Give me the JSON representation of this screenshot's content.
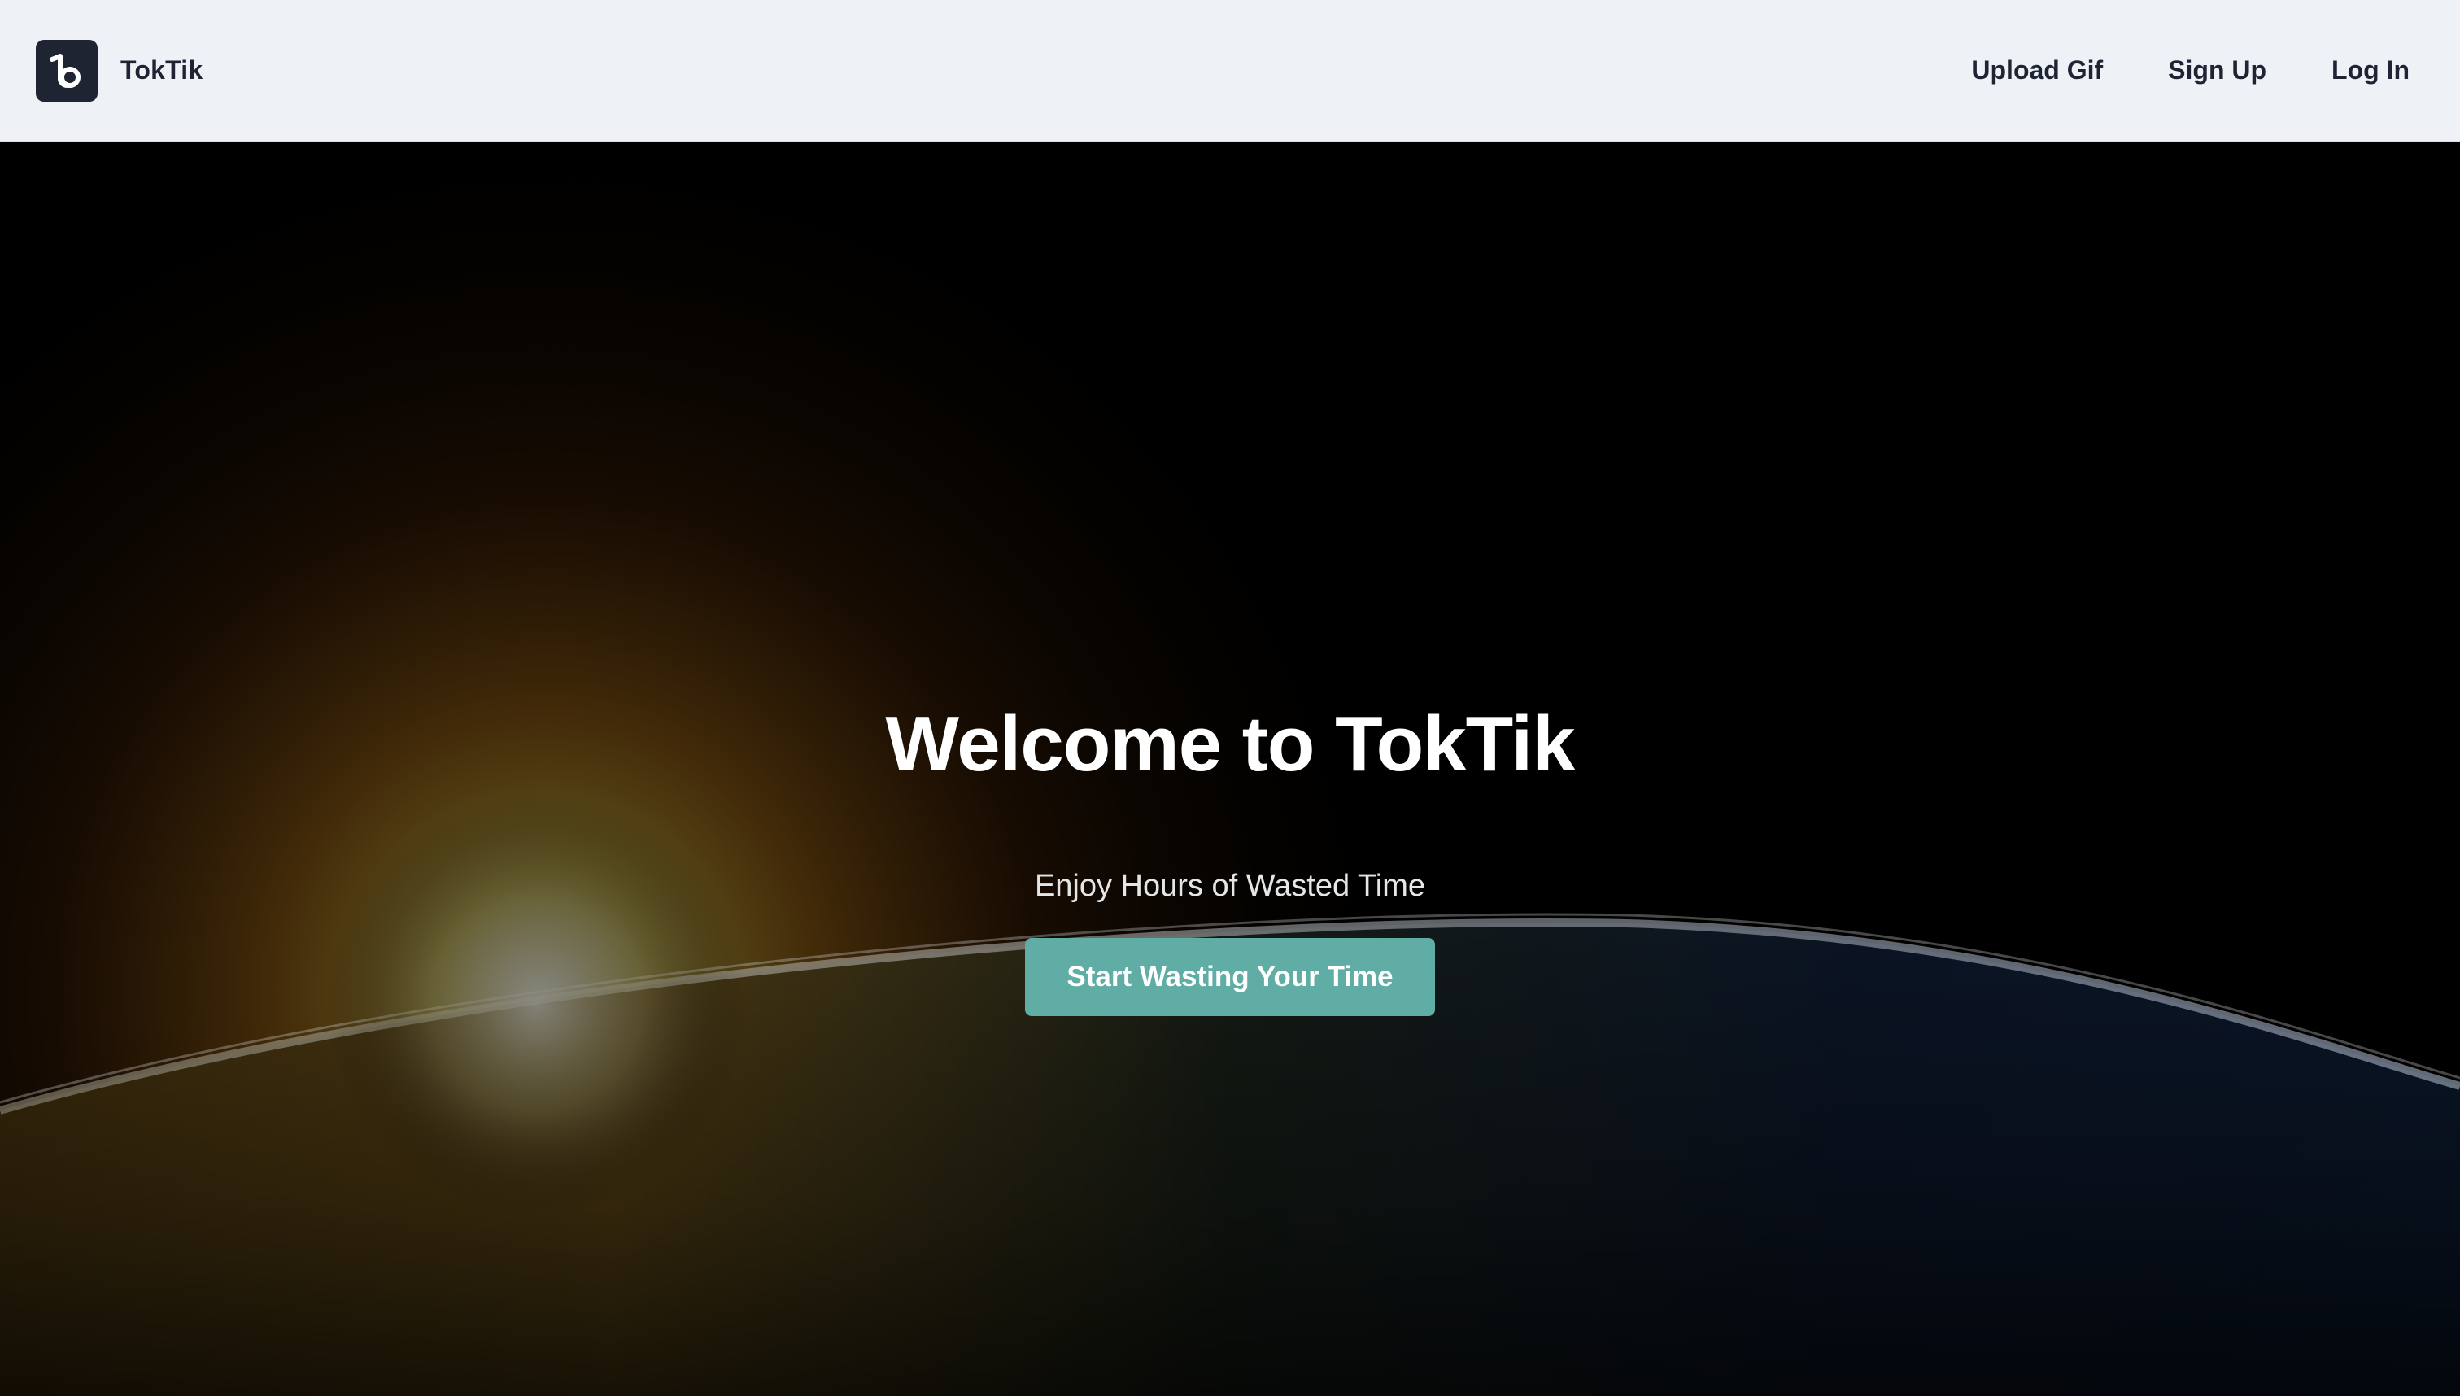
{
  "header": {
    "logo_icon": "tiktok-style-logo-icon",
    "brand_name": "TokTik",
    "nav": [
      {
        "label": "Upload Gif"
      },
      {
        "label": "Sign Up"
      },
      {
        "label": "Log In"
      }
    ]
  },
  "hero": {
    "background": "earth-horizon-sunrise-image",
    "title": "Welcome to TokTik",
    "subtitle": "Enjoy Hours of Wasted Time",
    "cta_label": "Start Wasting Your Time"
  },
  "colors": {
    "navbar_bg": "#eef2f7",
    "logo_bg": "#1f2432",
    "text_dark": "#1e2433",
    "cta_bg": "#5fada5",
    "hero_text": "#ffffff"
  }
}
